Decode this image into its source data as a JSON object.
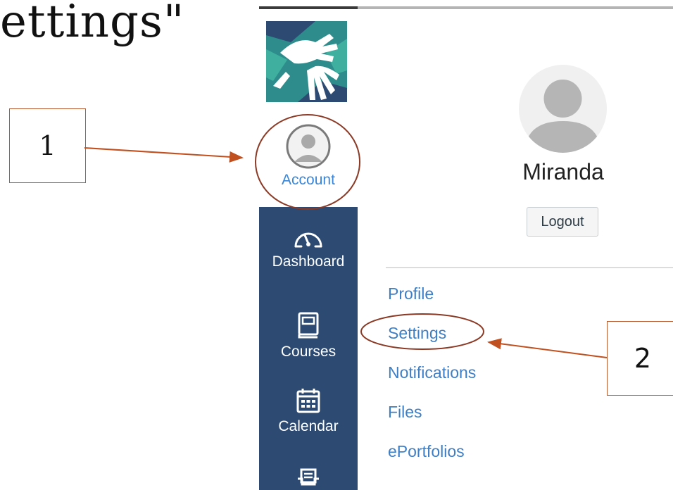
{
  "slide": {
    "title": "ettings\""
  },
  "callouts": [
    {
      "number": "1"
    },
    {
      "number": "2"
    }
  ],
  "global_nav": {
    "account_label": "Account",
    "items": [
      {
        "label": "Dashboard",
        "icon": "dashboard-icon"
      },
      {
        "label": "Courses",
        "icon": "courses-icon"
      },
      {
        "label": "Calendar",
        "icon": "calendar-icon"
      },
      {
        "label": "",
        "icon": "inbox-icon"
      }
    ]
  },
  "account_tray": {
    "user_name": "Miranda",
    "logout_label": "Logout",
    "links": [
      "Profile",
      "Settings",
      "Notifications",
      "Files",
      "ePortfolios"
    ]
  },
  "colors": {
    "nav_background": "#2c4a72",
    "link_blue": "#3d7fc6",
    "annotation": "#b85a30"
  }
}
